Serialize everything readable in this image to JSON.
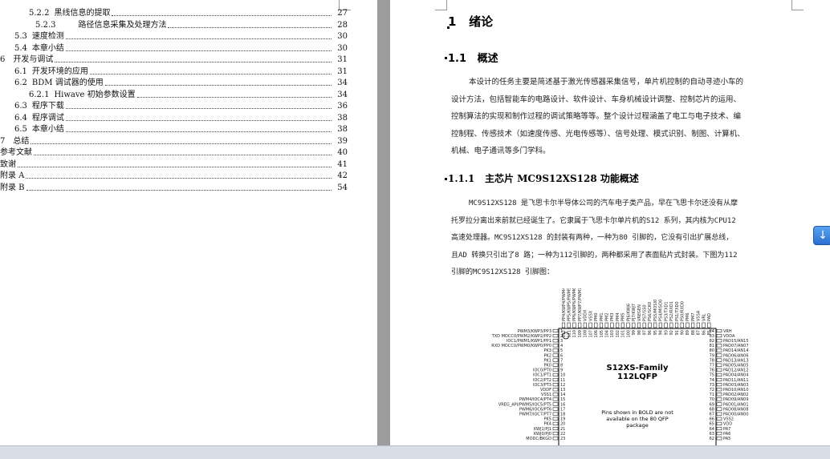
{
  "toc": [
    {
      "num": "5.2.2",
      "text": "黑线信息的提取",
      "page": "27"
    },
    {
      "num": "5.2.3",
      "text": "路径信息采集及处理方法",
      "page": "28"
    },
    {
      "num": "5.3",
      "text": "速度检测",
      "page": "30"
    },
    {
      "num": "5.4",
      "text": "本章小结",
      "page": "30"
    },
    {
      "num": "6",
      "text": "开发与调试",
      "page": "31"
    },
    {
      "num": "6.1",
      "text": "开发环境的应用",
      "page": "31"
    },
    {
      "num": "6.2",
      "text": "BDM 调试器的使用",
      "page": "34"
    },
    {
      "num": "6.2.1",
      "text": "Hiwave 初始参数设置",
      "page": "34"
    },
    {
      "num": "6.3",
      "text": "程序下载",
      "page": "36"
    },
    {
      "num": "6.4",
      "text": "程序调试",
      "page": "38"
    },
    {
      "num": "6.5",
      "text": "本章小结",
      "page": "38"
    },
    {
      "num": "7",
      "text": "总结",
      "page": "39"
    },
    {
      "num": "",
      "text": "参考文献",
      "page": "40"
    },
    {
      "num": "",
      "text": "致谢",
      "page": "41"
    },
    {
      "num": "",
      "text": "附录 A",
      "page": "42"
    },
    {
      "num": "",
      "text": "附录 B",
      "page": "54"
    }
  ],
  "doc": {
    "h1_num": "1",
    "h1_text": "绪论",
    "h2_num": "1.1",
    "h2_text": "概述",
    "p1": [
      "本设计的任务主要是简述基于激光传感器采集信号，单片机控制的自动寻迹小车的",
      "设计方法，包括智能车的电路设计、软件设计、车身机械设计调整、控制芯片的运用、",
      "控制算法的实现和制作过程的调试策略等等。整个设计过程涵盖了电工与电子技术、编",
      "控制程、传感技术（如速度传感、光电传感等）、信号处理、模式识别、制图、计算机、",
      "机械、电子通讯等多门学科。"
    ],
    "h3_num": "1.1.1",
    "h3_text": "主芯片 MC9S12XS128 功能概述",
    "p2": [
      "MC9S12XS128 是飞思卡尔半导体公司的汽车电子类产品，早在飞思卡尔还没有从摩",
      "托罗拉分离出来前就已经诞生了。它隶属于飞思卡尔单片机的S12 系列，其内核为CPU12",
      "高速处理器。MC9S12XS128 的封装有两种，一种为80 引脚的，它没有引出扩展总线，",
      "且AD 转换只引出了8 路；一种为112引脚的，两种都采用了表面贴片式封装。下图为112",
      "引脚的MC9S12XS128 引脚图："
    ]
  },
  "chip": {
    "title1": "S12XS-Family",
    "title2": "112LQFP",
    "note1": "Pins shown in BOLD are not",
    "note2": "available on the 80 QFP",
    "note3": "package",
    "left_pins": [
      {
        "n": "1",
        "label": "PWM3/KWP3/PP3"
      },
      {
        "n": "2",
        "label": "TXD MOCC0/PWM2/KWP2/PP2"
      },
      {
        "n": "3",
        "label": "IOC1/PWM1/KWP1/PP1"
      },
      {
        "n": "4",
        "label": "RXD MOCC0/PWM0/KWP0/PP0"
      },
      {
        "n": "5",
        "label": "PK3"
      },
      {
        "n": "6",
        "label": "PK2"
      },
      {
        "n": "7",
        "label": "PK1"
      },
      {
        "n": "8",
        "label": "PK0"
      },
      {
        "n": "9",
        "label": "IOC0/PT0"
      },
      {
        "n": "10",
        "label": "IOC1/PT1"
      },
      {
        "n": "11",
        "label": "IOC2/PT2"
      },
      {
        "n": "12",
        "label": "IOC3/PT3"
      },
      {
        "n": "13",
        "label": "VDDF"
      },
      {
        "n": "14",
        "label": "VSS1"
      },
      {
        "n": "15",
        "label": "PWM4/IOC4/PT4"
      },
      {
        "n": "16",
        "label": "VREG_API/PWM5/IOC5/PT5"
      },
      {
        "n": "17",
        "label": "PWM6/IOC6/PT6"
      },
      {
        "n": "18",
        "label": "PWM7/IOC7/PT7"
      },
      {
        "n": "19",
        "label": "PK5"
      },
      {
        "n": "20",
        "label": "PK4"
      },
      {
        "n": "21",
        "label": "KWJ1/PJ1"
      },
      {
        "n": "22",
        "label": "KWJ0/PJ0"
      },
      {
        "n": "23",
        "label": "MODC/BKGD"
      }
    ],
    "right_pins": [
      {
        "n": "84",
        "label": "VRH"
      },
      {
        "n": "83",
        "label": "VDDA"
      },
      {
        "n": "82",
        "label": "PAD15/AN15"
      },
      {
        "n": "81",
        "label": "PAD07/AN07"
      },
      {
        "n": "80",
        "label": "PAD14/AN14"
      },
      {
        "n": "79",
        "label": "PAD06/AN06"
      },
      {
        "n": "78",
        "label": "PAD13/AN13"
      },
      {
        "n": "77",
        "label": "PAD05/AN05"
      },
      {
        "n": "76",
        "label": "PAD12/AN12"
      },
      {
        "n": "75",
        "label": "PAD04/AN04"
      },
      {
        "n": "74",
        "label": "PAD11/AN11"
      },
      {
        "n": "73",
        "label": "PAD03/AN03"
      },
      {
        "n": "72",
        "label": "PAD10/AN10"
      },
      {
        "n": "71",
        "label": "PAD02/AN02"
      },
      {
        "n": "70",
        "label": "PAD09/AN09"
      },
      {
        "n": "69",
        "label": "PAD01/AN01"
      },
      {
        "n": "68",
        "label": "PAD08/AN08"
      },
      {
        "n": "67",
        "label": "PAD00/AN00"
      },
      {
        "n": "66",
        "label": "VSS2"
      },
      {
        "n": "65",
        "label": "VDD"
      },
      {
        "n": "64",
        "label": "PA7"
      },
      {
        "n": "63",
        "label": "PA6"
      },
      {
        "n": "62",
        "label": "PA5"
      }
    ],
    "top_pins": [
      {
        "n": "112",
        "label": "PP4/KWP4/PWM4"
      },
      {
        "n": "111",
        "label": "PP5/KWP5/PWM5"
      },
      {
        "n": "110",
        "label": "PP6/KWP6/PWM6"
      },
      {
        "n": "109",
        "label": "PP7/KWP7/PWM7"
      },
      {
        "n": "108",
        "label": "VDDX"
      },
      {
        "n": "107",
        "label": "VSSX"
      },
      {
        "n": "106",
        "label": "PM0"
      },
      {
        "n": "105",
        "label": "PM1"
      },
      {
        "n": "104",
        "label": "PM2"
      },
      {
        "n": "103",
        "label": "PM3"
      },
      {
        "n": "102",
        "label": "PM4"
      },
      {
        "n": "101",
        "label": "PM5"
      },
      {
        "n": "100",
        "label": "PJ6/KWJ6"
      },
      {
        "n": "99",
        "label": "PJ7/KWJ7"
      },
      {
        "n": "98",
        "label": "VREGEN"
      },
      {
        "n": "97",
        "label": "PS7/SS0"
      },
      {
        "n": "96",
        "label": "PS6/SCK0"
      },
      {
        "n": "95",
        "label": "PS5/MOSI0"
      },
      {
        "n": "94",
        "label": "PS4/MISO0"
      },
      {
        "n": "93",
        "label": "PS3/TXD1"
      },
      {
        "n": "92",
        "label": "PS2/RXD1"
      },
      {
        "n": "91",
        "label": "PS1/TXD0"
      },
      {
        "n": "90",
        "label": "PS0/RXD0"
      },
      {
        "n": "89",
        "label": "PM6"
      },
      {
        "n": "88",
        "label": "PM7"
      },
      {
        "n": "87",
        "label": "VSSA"
      },
      {
        "n": "86",
        "label": "VRL"
      },
      {
        "n": "85",
        "label": "PAD"
      }
    ]
  },
  "scroll_button_glyph": "↓",
  "colors": {
    "gray_bg": "#9c9c9c",
    "status_bar": "#d8dde6",
    "scroll_button": "#3d86df"
  }
}
